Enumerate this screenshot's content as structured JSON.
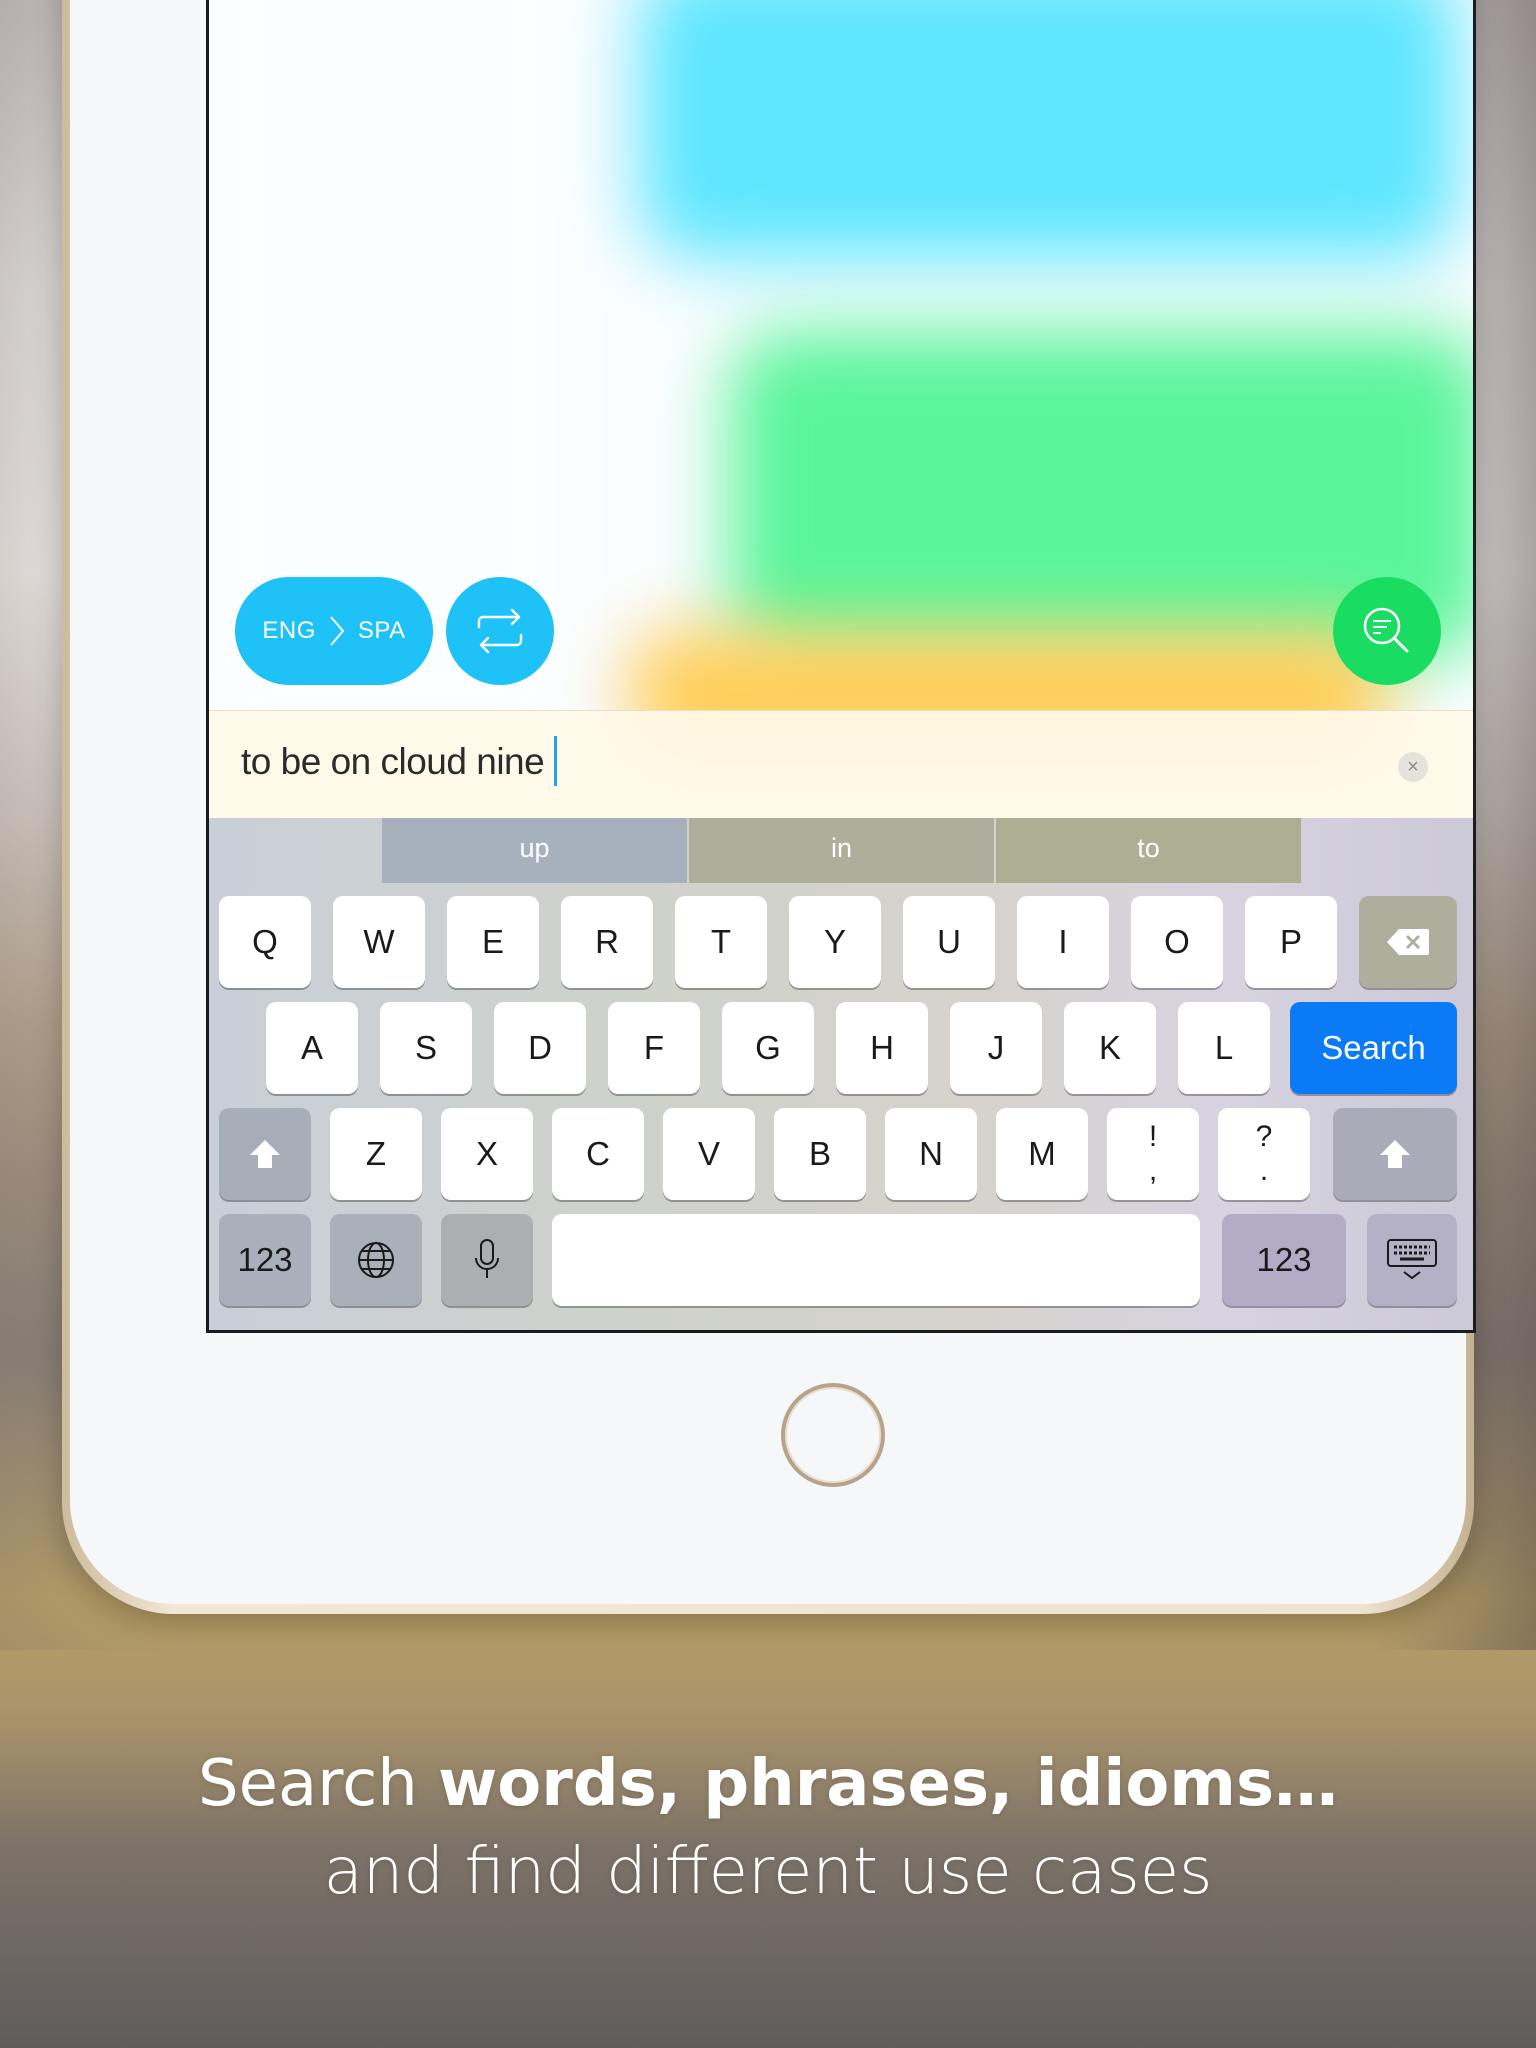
{
  "app": {
    "language_pair": {
      "from": "ENG",
      "to": "SPA"
    },
    "swap_icon": "swap-arrows-icon",
    "search_icon": "search-results-icon",
    "accent_color": "#1fc2f7",
    "search_color": "#1bdc62"
  },
  "input": {
    "value": "to be on cloud nine",
    "clear_label": "×"
  },
  "keyboard": {
    "suggestions": [
      "up",
      "in",
      "to"
    ],
    "row1": [
      "Q",
      "W",
      "E",
      "R",
      "T",
      "Y",
      "U",
      "I",
      "O",
      "P"
    ],
    "row2": [
      "A",
      "S",
      "D",
      "F",
      "G",
      "H",
      "J",
      "K",
      "L"
    ],
    "row3": [
      "Z",
      "X",
      "C",
      "V",
      "B",
      "N",
      "M"
    ],
    "punct1": {
      "top": "!",
      "bottom": ","
    },
    "punct2": {
      "top": "?",
      "bottom": "."
    },
    "return_label": "Search",
    "numbers_label": "123",
    "numbers_label_right": "123",
    "return_color": "#0a7af7"
  },
  "caption": {
    "line1_regular": "Search ",
    "line1_bold": "words, phrases, idioms…",
    "line2": "and find different use cases"
  }
}
